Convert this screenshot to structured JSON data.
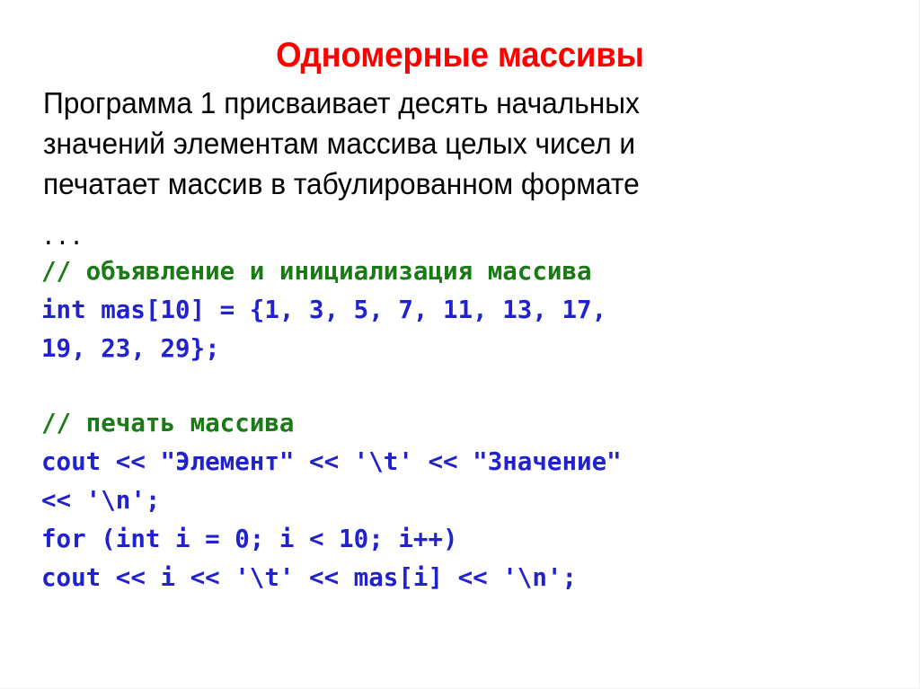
{
  "slide": {
    "title": "Одномерные массивы",
    "title_color": "#ff0000",
    "background_color": "#ffffff"
  },
  "prose": {
    "lines": [
      "Программа 1 присваивает десять начальных",
      "значений элементам массива целых чисел и",
      "печатает массив в табулированном формате"
    ],
    "text_color": "#000000"
  },
  "code": {
    "comment_color": "#1a7a15",
    "statement_color": "#2222cc",
    "plain_color": "#000000",
    "lines": [
      {
        "kind": "plain",
        "text": "..."
      },
      {
        "kind": "comment",
        "text": "// объявление и инициализация массива"
      },
      {
        "kind": "statement",
        "text": "int mas[10] = {1, 3, 5, 7, 11, 13, 17,"
      },
      {
        "kind": "statement",
        "text": "19, 23, 29};"
      },
      {
        "kind": "blank",
        "text": ""
      },
      {
        "kind": "comment",
        "text": "// печать массива"
      },
      {
        "kind": "statement",
        "text": "cout << \"Элемент\" << '\\t' << \"Значение\""
      },
      {
        "kind": "statement",
        "text": "<< '\\n';"
      },
      {
        "kind": "statement",
        "text": "for (int i = 0; i < 10; i++)"
      },
      {
        "kind": "statement",
        "text": "cout << i << '\\t' << mas[i] << '\\n';"
      }
    ]
  },
  "array": {
    "name": "mas",
    "type": "int",
    "size": 10,
    "values": [
      1,
      3,
      5,
      7,
      11,
      13,
      17,
      19,
      23,
      29
    ]
  }
}
